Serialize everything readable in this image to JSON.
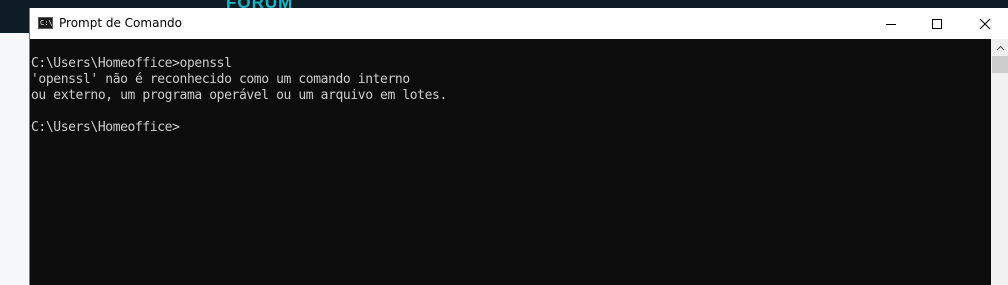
{
  "background": {
    "banner_text": "FORUM"
  },
  "window": {
    "title": "Prompt de Comando",
    "icon": "cmd-icon",
    "icon_glyph": "C:\\",
    "controls": {
      "minimize": "minimize-icon",
      "maximize": "maximize-icon",
      "close": "close-icon"
    }
  },
  "console": {
    "lines": [
      "C:\\Users\\Homeoffice>openssl",
      "'openssl' não é reconhecido como um comando interno",
      "ou externo, um programa operável ou um arquivo em lotes.",
      "",
      "C:\\Users\\Homeoffice>"
    ]
  },
  "colors": {
    "console_bg": "#0c0c0c",
    "console_text": "#cccccc",
    "titlebar_bg": "#ffffff",
    "banner_bg": "#0e1c26",
    "banner_accent": "#17b6c4"
  }
}
